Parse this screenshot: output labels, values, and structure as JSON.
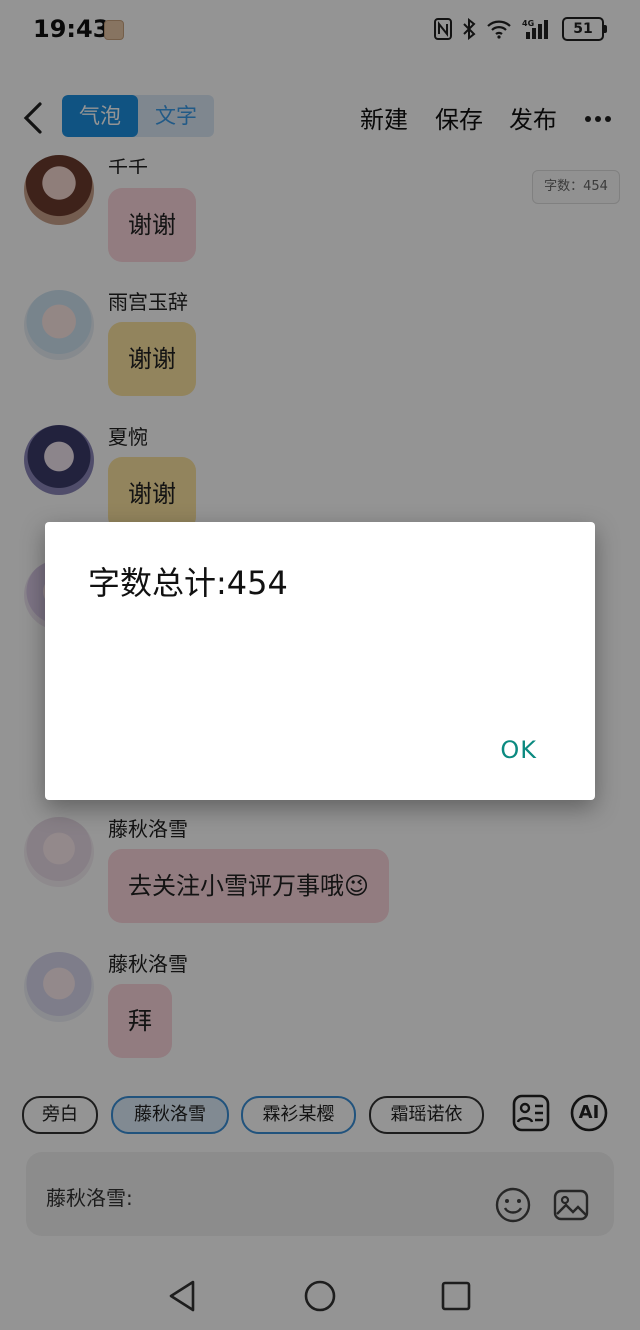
{
  "status_bar": {
    "time": "19:43",
    "battery": "51",
    "icons": [
      "nfc-icon",
      "bluetooth-icon",
      "wifi-icon",
      "signal-4g-icon",
      "battery-icon"
    ]
  },
  "toolbar": {
    "back_icon": "chevron-left-icon",
    "segments": [
      "气泡",
      "文字"
    ],
    "active_segment": "气泡",
    "new_label": "新建",
    "save_label": "保存",
    "publish_label": "发布",
    "more_icon": "more-horizontal-icon"
  },
  "word_count_badge": "字数：454",
  "messages": [
    {
      "sender": "千千",
      "text": "谢谢",
      "bubble_color": "#fbd6dc"
    },
    {
      "sender": "雨宫玉辞",
      "text": "谢谢",
      "bubble_color": "#fbe3a0"
    },
    {
      "sender": "夏惋",
      "text": "谢谢",
      "bubble_color": "#fbe3a0"
    },
    {
      "sender": "藤秋洛雪",
      "text": "去关注小雪评万事哦😉",
      "bubble_color": "#fbd6dc"
    },
    {
      "sender": "藤秋洛雪",
      "text": "拜",
      "bubble_color": "#fbd6dc"
    }
  ],
  "roles": {
    "chips": [
      "旁白",
      "藤秋洛雪",
      "霖衫某樱",
      "霜瑶诺依"
    ],
    "selected": "藤秋洛雪",
    "contacts_icon": "contact-card-icon",
    "ai_label": "AI"
  },
  "input": {
    "label": "藤秋洛雪:",
    "emoji_icon": "emoji-icon",
    "image_icon": "image-icon"
  },
  "nav": [
    "back-triangle-icon",
    "home-circle-icon",
    "recents-square-icon"
  ],
  "dialog": {
    "message": "字数总计:454",
    "ok_label": "OK"
  },
  "colors": {
    "accent": "#1d8fe0",
    "ok_text": "#0b8a80",
    "pink_bubble": "#fbd6dc",
    "yellow_bubble": "#fbe3a0"
  }
}
